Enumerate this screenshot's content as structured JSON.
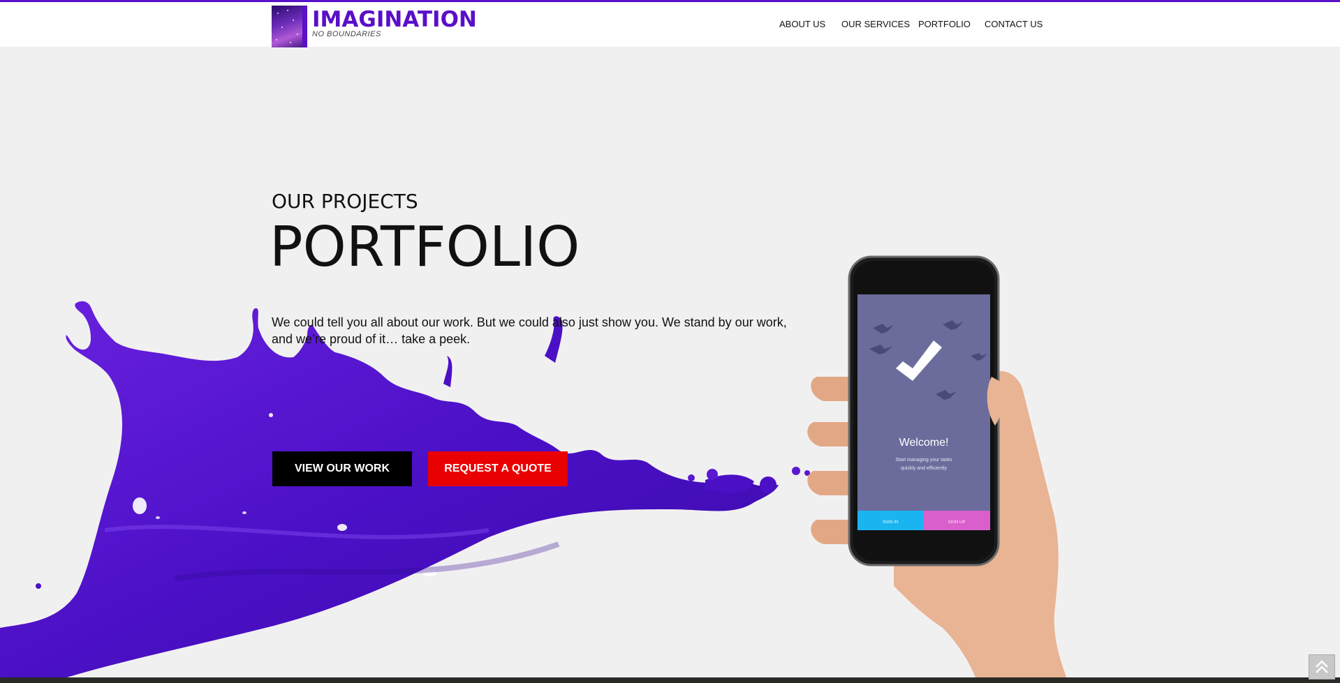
{
  "brand": {
    "name": "IMAGINATION",
    "tagline": "NO BOUNDARIES",
    "accent_color": "#5a0fc8"
  },
  "nav": {
    "items": [
      {
        "label": "ABOUT US"
      },
      {
        "label": "OUR SERVICES"
      },
      {
        "label": "PORTFOLIO"
      },
      {
        "label": "CONTACT US"
      }
    ]
  },
  "hero": {
    "kicker": "OUR PROJECTS",
    "title": "PORTFOLIO",
    "description": "We could tell you all about our work. But we could also just show you. We stand by our work, and we’re proud of it… take a peek.",
    "buttons": {
      "view_work": "VIEW OUR WORK",
      "request_quote": "REQUEST A QUOTE"
    },
    "button_colors": {
      "view_work": "#000000",
      "request_quote": "#e90000"
    }
  },
  "phone_screen": {
    "welcome": "Welcome!",
    "subtitle_line1": "Start managing your tasks",
    "subtitle_line2": "quickly and efficiently",
    "sign_in": "SIGN IN",
    "sign_up": "SIGN UP"
  },
  "icons": {
    "back_to_top": "double-chevron-up-icon",
    "check": "checkmark-icon"
  }
}
